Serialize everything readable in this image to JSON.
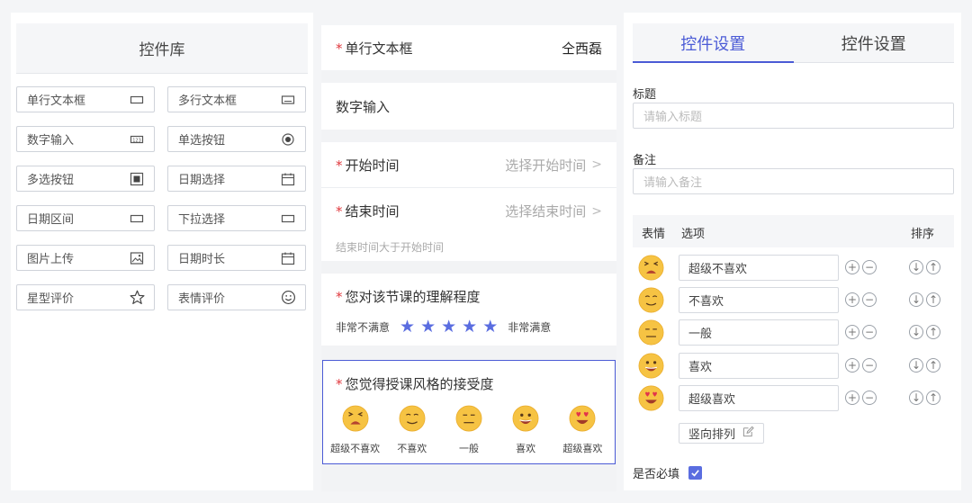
{
  "library": {
    "title": "控件库",
    "widgets": [
      {
        "label": "单行文本框",
        "icon": "single-line-text-icon"
      },
      {
        "label": "多行文本框",
        "icon": "multi-line-text-icon"
      },
      {
        "label": "数字输入",
        "icon": "number-input-icon"
      },
      {
        "label": "单选按钮",
        "icon": "radio-icon"
      },
      {
        "label": "多选按钮",
        "icon": "checkbox-icon"
      },
      {
        "label": "日期选择",
        "icon": "calendar-icon"
      },
      {
        "label": "日期区间",
        "icon": "date-range-icon"
      },
      {
        "label": "下拉选择",
        "icon": "dropdown-icon"
      },
      {
        "label": "图片上传",
        "icon": "image-icon"
      },
      {
        "label": "日期时长",
        "icon": "calendar-icon"
      },
      {
        "label": "星型评价",
        "icon": "star-icon"
      },
      {
        "label": "表情评价",
        "icon": "smiley-icon"
      }
    ]
  },
  "form": {
    "single_text": {
      "label": "单行文本框",
      "value": "仝西磊"
    },
    "number": {
      "label": "数字输入"
    },
    "start_time": {
      "label": "开始时间",
      "placeholder": "选择开始时间"
    },
    "end_time": {
      "label": "结束时间",
      "placeholder": "选择结束时间",
      "hint": "结束时间大于开始时间"
    },
    "star_rating": {
      "label": "您对该节课的理解程度",
      "left": "非常不满意",
      "right": "非常满意",
      "stars": 5,
      "value": 5
    },
    "emoji_rating": {
      "label": "您觉得授课风格的接受度",
      "options": [
        "超级不喜欢",
        "不喜欢",
        "一般",
        "喜欢",
        "超级喜欢"
      ]
    }
  },
  "settings": {
    "tabs": [
      "控件设置",
      "控件设置"
    ],
    "title_label": "标题",
    "title_placeholder": "请输入标题",
    "note_label": "备注",
    "note_placeholder": "请输入备注",
    "columns": {
      "emoji": "表情",
      "option": "选项",
      "order": "排序"
    },
    "options": [
      "超级不喜欢",
      "不喜欢",
      "一般",
      "喜欢",
      "超级喜欢"
    ],
    "vertical_label": "竖向排列",
    "required_label": "是否必填",
    "required_checked": true
  },
  "colors": {
    "accent": "#4b5bd6",
    "star": "#5a6de0",
    "required": "#e0393e",
    "emoji": "#f6c343"
  }
}
